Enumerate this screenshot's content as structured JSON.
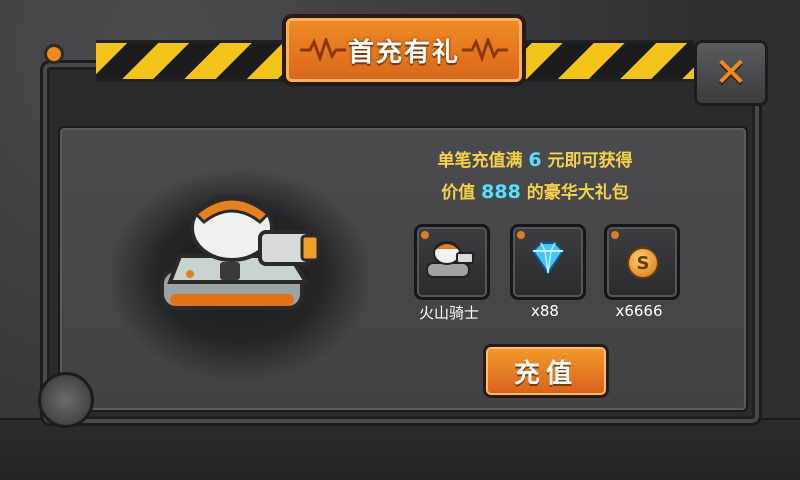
{
  "title": "首充有礼",
  "offer": {
    "line1_prefix": "单笔充值满",
    "line1_amount": "6",
    "line1_suffix": "元即可获得",
    "line2_prefix": "价值",
    "line2_value": "888",
    "line2_suffix": "的豪华大礼包"
  },
  "rewards": [
    {
      "label": "火山骑士",
      "icon": "tank-icon"
    },
    {
      "label": "x88",
      "icon": "diamond-icon"
    },
    {
      "label": "x6666",
      "icon": "coin-icon",
      "glyph": "S"
    }
  ],
  "charge_button": "充值",
  "close_glyph": "✕",
  "colors": {
    "accent_orange": "#f08a1c",
    "text_yellow": "#f6d24a",
    "text_cyan": "#59e0ff",
    "hazard_yellow": "#f2c318"
  }
}
